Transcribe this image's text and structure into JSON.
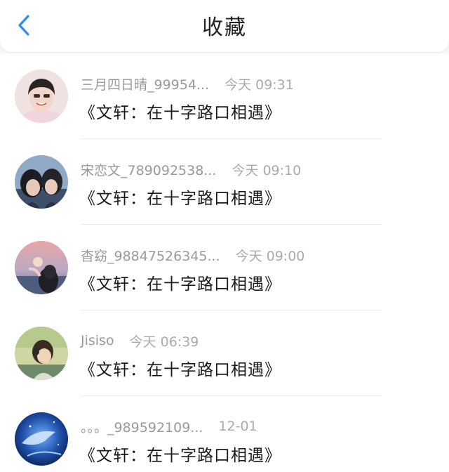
{
  "header": {
    "title": "收藏",
    "back_icon": "chevron-left-icon",
    "accent_color": "#2f8cf5"
  },
  "items": [
    {
      "name": "三月四日晴_99954...",
      "time": "今天 09:31",
      "title": "《文轩：在十字路口相遇》"
    },
    {
      "name": "宋恋文_789092538...",
      "time": "今天 09:10",
      "title": "《文轩：在十字路口相遇》"
    },
    {
      "name": "杳窈_98847526345...",
      "time": "今天 09:00",
      "title": "《文轩：在十字路口相遇》"
    },
    {
      "name": "Jisiso",
      "time": "今天 06:39",
      "title": "《文轩：在十字路口相遇》"
    },
    {
      "name": "。。。_989592109...",
      "time": "12-01",
      "title": "《文轩：在十字路口相遇》"
    }
  ]
}
